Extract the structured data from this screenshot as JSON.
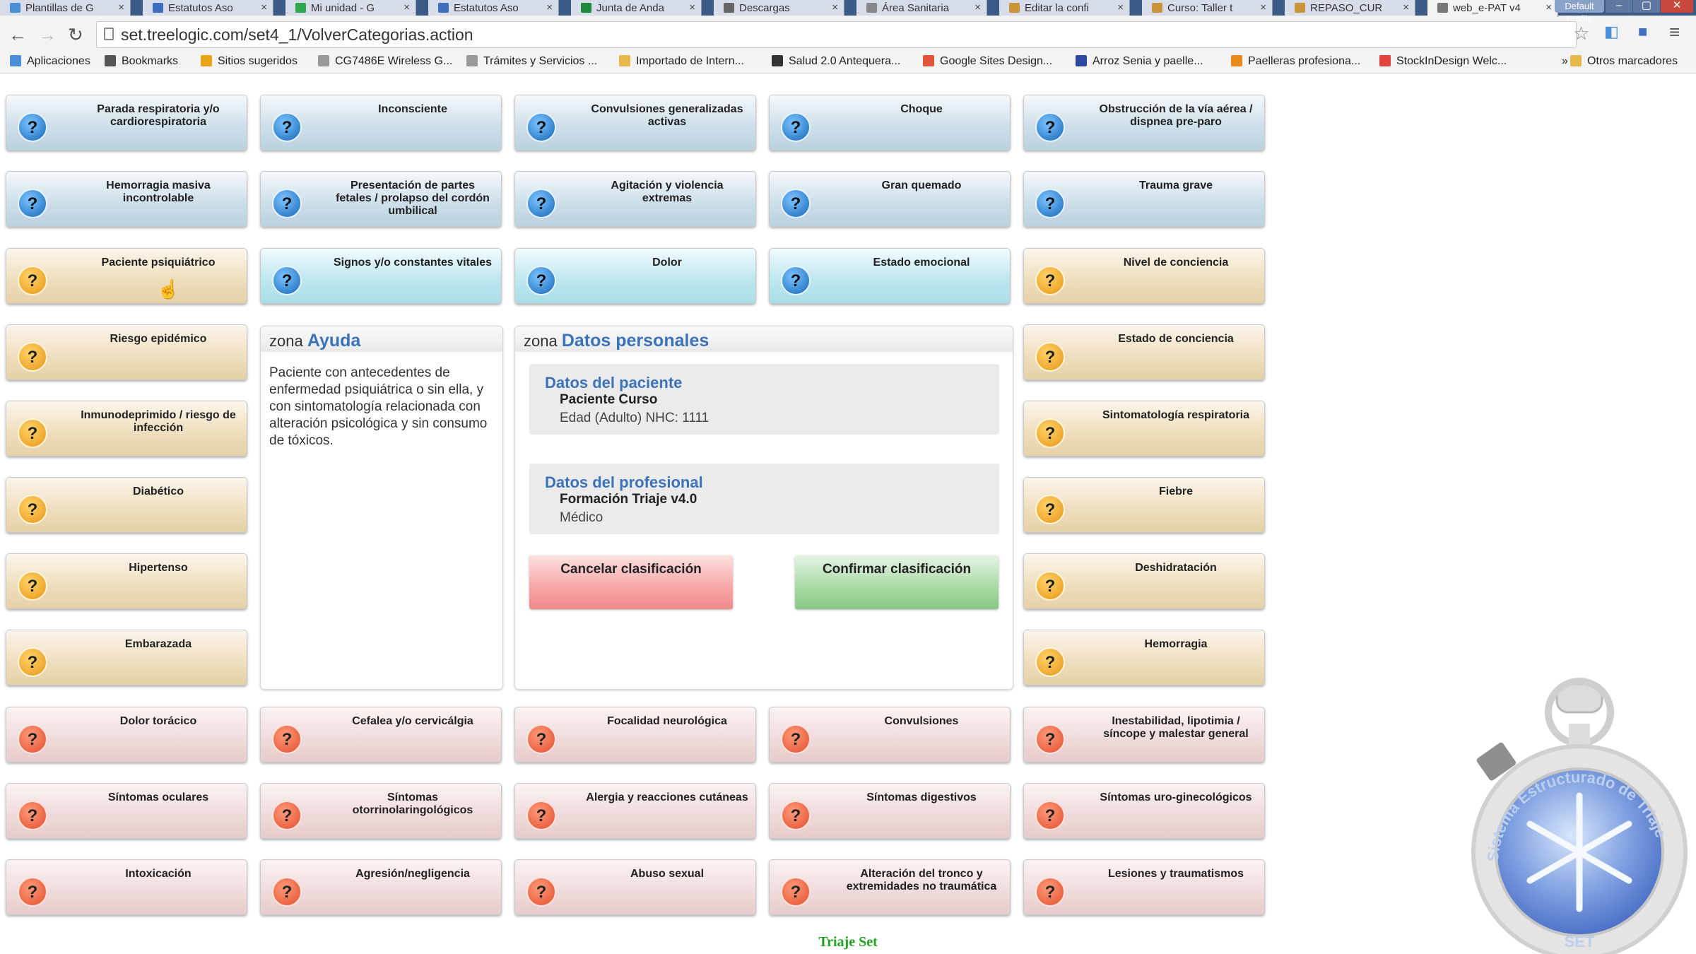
{
  "browser": {
    "tabs": [
      {
        "title": "Plantillas de G",
        "color": "#4a8fd6"
      },
      {
        "title": "Estatutos Aso",
        "color": "#3e6fbf"
      },
      {
        "title": "Mi unidad - G",
        "color": "#2fa84f"
      },
      {
        "title": "Estatutos Aso",
        "color": "#3e6fbf"
      },
      {
        "title": "Junta de Anda",
        "color": "#1f8a3c"
      },
      {
        "title": "Descargas",
        "color": "#666666"
      },
      {
        "title": "Área Sanitaria",
        "color": "#888888"
      },
      {
        "title": "Editar la confi",
        "color": "#c9933a"
      },
      {
        "title": "Curso: Taller t",
        "color": "#c9933a"
      },
      {
        "title": "REPASO_CUR",
        "color": "#c9933a"
      },
      {
        "title": "web_e-PAT v4",
        "color": "#777777",
        "active": true
      }
    ],
    "profile": "Default Profile",
    "url": "set.treelogic.com/set4_1/VolverCategorias.action",
    "bookmarks": [
      {
        "label": "Aplicaciones",
        "color": "#4a8fd6"
      },
      {
        "label": "Bookmarks",
        "color": "#555555"
      },
      {
        "label": "Sitios sugeridos",
        "color": "#e8a317"
      },
      {
        "label": "CG7486E Wireless G...",
        "color": "#999999"
      },
      {
        "label": "Trámites y Servicios ...",
        "color": "#999999"
      },
      {
        "label": "Importado de Intern...",
        "color": "#e8b84a"
      },
      {
        "label": "Salud 2.0 Antequera...",
        "color": "#333333"
      },
      {
        "label": "Google Sites Design...",
        "color": "#e2533a"
      },
      {
        "label": "Arroz Senia y paelle...",
        "color": "#2e4a9e"
      },
      {
        "label": "Paelleras profesiona...",
        "color": "#e88a1a"
      },
      {
        "label": "StockInDesign Welc...",
        "color": "#e0443a"
      },
      {
        "label": "»",
        "color": "#f3f3f3"
      },
      {
        "label": "Otros marcadores",
        "color": "#e8b84a"
      }
    ]
  },
  "categories": {
    "row1": [
      "Parada respiratoria y/o cardiorespiratoria",
      "Inconsciente",
      "Convulsiones generalizadas activas",
      "Choque",
      "Obstrucción de la vía aérea / dispnea pre-paro"
    ],
    "row2": [
      "Hemorragia masiva incontrolable",
      "Presentación de partes fetales / prolapso del cordón umbilical",
      "Agitación y violencia extremas",
      "Gran quemado",
      "Trauma grave"
    ],
    "row3": [
      "Paciente psiquiátrico",
      "Signos y/o constantes vitales",
      "Dolor",
      "Estado emocional",
      "Nivel de conciencia"
    ],
    "left": [
      "Riesgo epidémico",
      "Inmunodeprimido / riesgo de infección",
      "Diabético",
      "Hipertenso",
      "Embarazada"
    ],
    "right": [
      "Estado de conciencia",
      "Sintomatología respiratoria",
      "Fiebre",
      "Deshidratación",
      "Hemorragia"
    ],
    "row9": [
      "Dolor torácico",
      "Cefalea y/o cervicálgia",
      "Focalidad neurológica",
      "Convulsiones",
      "Inestabilidad, lipotimia / síncope y malestar general"
    ],
    "row10": [
      "Síntomas oculares",
      "Síntomas otorrinolaringológicos",
      "Alergia y reacciones cutáneas",
      "Síntomas digestivos",
      "Síntomas uro-ginecológicos"
    ],
    "row11": [
      "Intoxicación",
      "Agresión/negligencia",
      "Abuso sexual",
      "Alteración del tronco y extremidades no traumática",
      "Lesiones y traumatismos"
    ],
    "help_glyph": "?"
  },
  "help": {
    "zone": "zona",
    "title": "Ayuda",
    "text": "Paciente con antecedentes de enfermedad psiquiátrica o sin ella, y con sintomatología relacionada con alteración psicológica y sin consumo de tóxicos."
  },
  "personal": {
    "zone": "zona",
    "title": "Datos personales",
    "patient": {
      "heading": "Datos del paciente",
      "name": "Paciente Curso",
      "detail": "Edad (Adulto) NHC: 1111"
    },
    "professional": {
      "heading": "Datos del profesional",
      "name": "Formación Triaje v4.0",
      "detail": "Médico"
    },
    "cancel": "Cancelar clasificación",
    "confirm": "Confirmar clasificación"
  },
  "footer": "Triaje Set",
  "logo": {
    "ring_text": "Sistema Estructurado de Triaje",
    "label": "SET"
  },
  "colors": {
    "blue_card": "#cfe0ea",
    "aqua_card": "#bfe8ef",
    "orange_card": "#efdfbe",
    "pink_card": "#f0dcdc",
    "accent": "#3b73b9",
    "footer": "#22a322"
  }
}
